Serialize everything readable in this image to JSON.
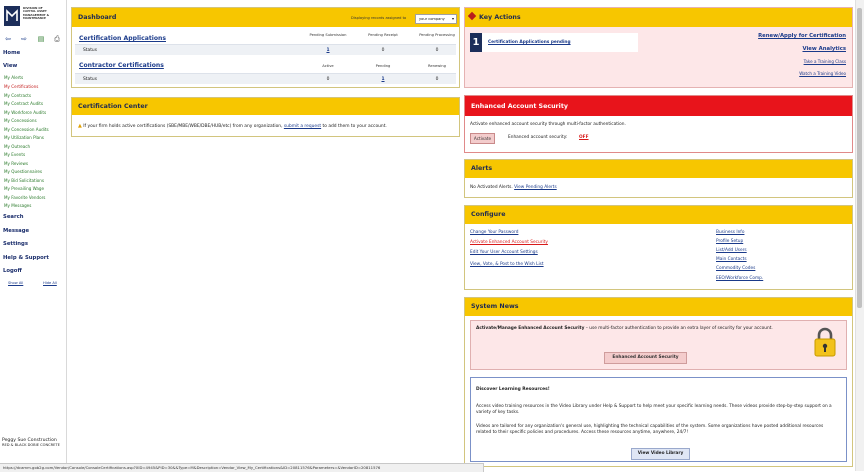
{
  "sidebar": {
    "logo_lines": [
      "Division of",
      "Capital Asset",
      "Management &",
      "Maintenance"
    ],
    "tool_icons": [
      "back-arrow-icon",
      "forward-arrow-icon",
      "export-icon",
      "print-icon"
    ],
    "sections": {
      "home": "Home",
      "view": "View",
      "search": "Search",
      "message": "Message",
      "settings": "Settings",
      "help": "Help & Support",
      "logoff": "Logoff"
    },
    "view_links": [
      "My Alerts",
      "My Certifications",
      "My Contracts",
      "My Contract Audits",
      "My Workforce Audits",
      "My Concessions",
      "My Concession Audits",
      "My Utilization Plans",
      "My Outreach",
      "My Events",
      "My Reviews",
      "My Questionnaires",
      "My Bid Solicitations",
      "My Prevailing Wage",
      "My Favorite Vendors",
      "My Messages"
    ],
    "active_link": "My Certifications",
    "show_all": "Show All",
    "hide_all": "Hide All",
    "company_name": "Peggy Sue Construction",
    "company_sub": "Red & Black Dobie Concrete"
  },
  "dashboard": {
    "title": "Dashboard",
    "displaying_label": "Displaying records assigned to",
    "company_select": "your company",
    "cert_apps": {
      "title": "Certification Applications",
      "cols": [
        "Pending Submission",
        "Pending Receipt",
        "Pending Processing"
      ],
      "row_label": "Status",
      "values": [
        "1",
        "0",
        "0"
      ]
    },
    "contractor_certs": {
      "title": "Contractor Certifications",
      "cols": [
        "Active",
        "Pending",
        "Renewing"
      ],
      "row_label": "Status",
      "values": [
        "0",
        "1",
        "0"
      ]
    }
  },
  "cert_center": {
    "title": "Certification Center",
    "msg_before": "If your firm holds active certifications (SBE/MBE/WBE/DBE/HUB/etc) from any organization,",
    "msg_link": "submit a request",
    "msg_after": "to add them to your account."
  },
  "key_actions": {
    "title": "Key Actions",
    "count": "1",
    "pending_link": "Certification Applications pending",
    "renew": "Renew/Apply for Certification",
    "analytics": "View Analytics",
    "training": "Take a Training Class",
    "video": "Watch a Training Video"
  },
  "security": {
    "title": "Enhanced Account Security",
    "desc": "Activate enhanced account security through multi-factor authentication.",
    "button": "Activate",
    "status_label": "Enhanced account security:",
    "status_value": "OFF"
  },
  "alerts": {
    "title": "Alerts",
    "msg": "No Activated Alerts.",
    "link": "View Pending Alerts"
  },
  "configure": {
    "title": "Configure",
    "left": [
      "Change Your Password",
      "Activate Enhanced Account Security",
      "Edit Your User Account Settings",
      "View, Vote, & Post to the Wish List"
    ],
    "right": [
      "Business Info",
      "Profile Setup",
      "List/Add Users",
      "Main Contacts",
      "Commodity Codes",
      "EEO/Workforce Comp."
    ]
  },
  "news": {
    "title": "System News",
    "b1_bold": "Activate/Manage Enhanced Account Security",
    "b1_text": " – use multi-factor authentication to provide an extra layer of security for your account.",
    "b1_button": "Enhanced Account Security",
    "b2_title": "Discover Learning Resources!",
    "b2_p1": "Access video training resources in the Video Library under Help & Support to help meet your specific learning needs. These videos provide step-by-step support on a variety of key tasks.",
    "b2_p2": "Videos are tailored for any organization's general use, highlighting the technical capabilities of the system. Some organizations have posted additional resources related to their specific policies and procedures. Access these resources anytime, anywhere, 24/7!",
    "b2_button": "View Video Library"
  },
  "status_url": "https://dcamm.gob2g.com/Vendor/Console/ConsoleCertifications.asp?XID=4945&PID=30&&Type=M&Description=Vendor_View_My_Certifications&ID=20811576&Parameters=&VendorID=20811576",
  "colors": {
    "panel_header": "#f7c600",
    "key_actions_bg": "#fde7e8",
    "security_header": "#e8141b",
    "link": "#1a3a8a",
    "sidebar_link": "#2a7a2a",
    "active_link": "#c41e1e",
    "logo_navy": "#1c2e5a"
  }
}
